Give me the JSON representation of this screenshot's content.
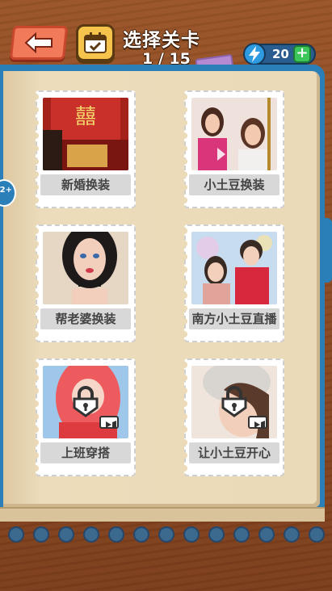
{
  "header": {
    "title": "选择关卡",
    "progress": "1 / 15",
    "energy": "20",
    "energy_plus": "+"
  },
  "side_badge": "2+",
  "levels": [
    {
      "label": "新婚换装",
      "locked": false
    },
    {
      "label": "小土豆换装",
      "locked": false
    },
    {
      "label": "帮老婆换装",
      "locked": false
    },
    {
      "label": "南方小土豆直播",
      "locked": false
    },
    {
      "label": "上班穿搭",
      "locked": true
    },
    {
      "label": "让小土豆开心",
      "locked": true
    }
  ],
  "colors": {
    "book_blue": "#2a7fb8",
    "page": "#e8d7b5",
    "back_button": "#f07a5a",
    "energy_plus": "#3cc65a"
  }
}
